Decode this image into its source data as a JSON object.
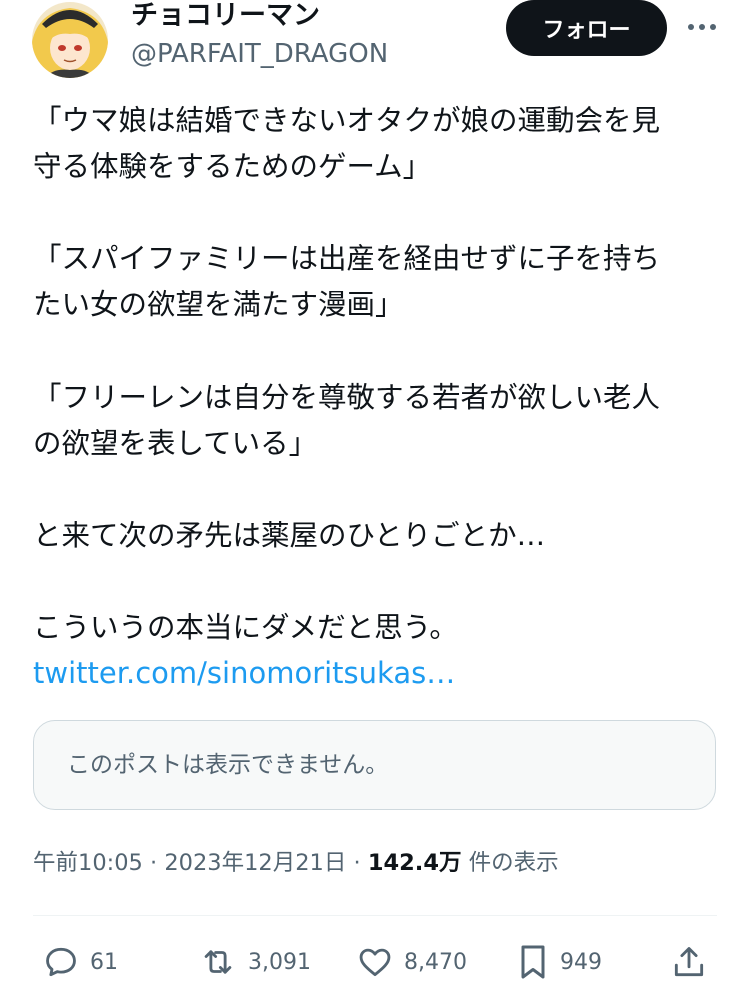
{
  "author": {
    "display_name": "チョコリーマン",
    "handle": "@PARFAIT_DRAGON",
    "avatar_icon": "avatar-icon"
  },
  "header": {
    "follow_label": "フォロー",
    "more_icon": "more-icon"
  },
  "tweet": {
    "lines": [
      "「ウマ娘は結婚できないオタクが娘の運動会を見",
      "守る体験をするためのゲーム」",
      "「スパイファミリーは出産を経由せずに子を持ち",
      "たい女の欲望を満たす漫画」",
      "「フリーレンは自分を尊敬する若者が欲しい老人",
      "の欲望を表している」",
      "と来て次の矛先は薬屋のひとりごとか…",
      "こういうの本当にダメだと思う。"
    ],
    "link": "twitter.com/sinomoritsukas…",
    "unavailable_notice": "このポストは表示できません。"
  },
  "meta": {
    "time": "午前10:05",
    "date": "2023年12月21日",
    "separator": "·",
    "views_count": "142.4万",
    "views_label": "件の表示"
  },
  "actions": {
    "replies": "61",
    "reposts": "3,091",
    "likes": "8,470",
    "bookmarks": "949"
  },
  "colors": {
    "text": "#0f1419",
    "secondary": "#536471",
    "link": "#1d9bf0",
    "border": "#cfd9de",
    "button_bg": "#0f1419"
  }
}
